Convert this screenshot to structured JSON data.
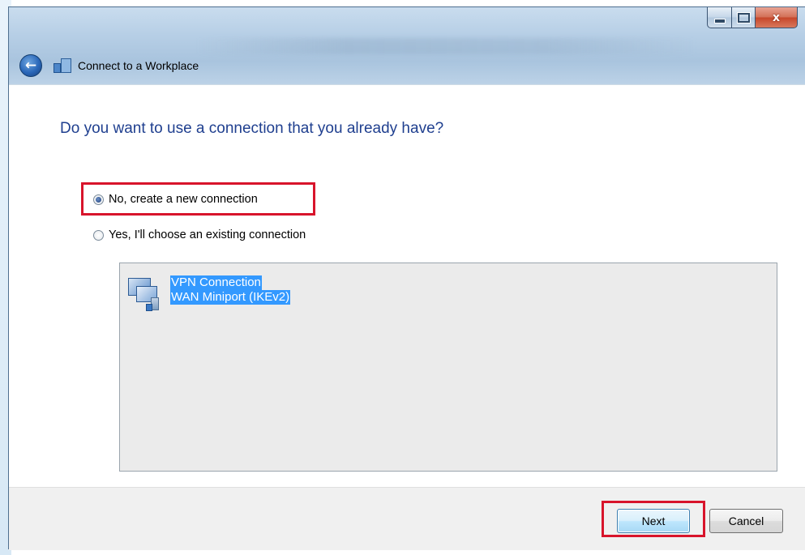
{
  "window": {
    "title": "Connect to a Workplace",
    "controls": {
      "close_glyph": "x"
    }
  },
  "nav": {
    "back_glyph": "←"
  },
  "main": {
    "heading": "Do you want to use a connection that you already have?",
    "options": [
      {
        "label": "No, create a new connection",
        "selected": true
      },
      {
        "label": "Yes, I'll choose an existing connection",
        "selected": false
      }
    ],
    "connection_list": {
      "items": [
        {
          "name": "VPN Connection",
          "device": "WAN Miniport (IKEv2)",
          "icon": "vpn-network-icon",
          "selected": true
        }
      ]
    }
  },
  "footer": {
    "next_label": "Next",
    "cancel_label": "Cancel"
  },
  "colors": {
    "heading": "#1f3f8f",
    "highlight_box": "#d8142b",
    "selection": "#3399ff"
  }
}
